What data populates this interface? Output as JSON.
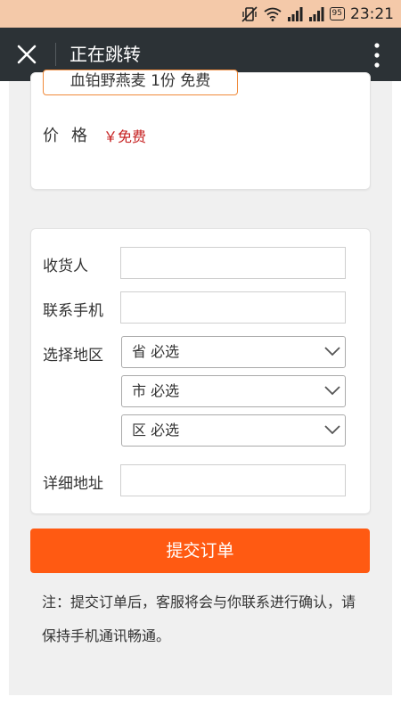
{
  "status_bar": {
    "battery": "95",
    "time": "23:21"
  },
  "title_bar": {
    "title": "正在跳转"
  },
  "product": {
    "tag": "血铂野燕麦 1份 免费",
    "price_label": "价格",
    "price_value": "￥免费"
  },
  "form": {
    "recipient_label": "收货人",
    "recipient_value": "",
    "phone_label": "联系手机",
    "phone_value": "",
    "region_label": "选择地区",
    "province_select": "省 必选",
    "city_select": "市 必选",
    "district_select": "区 必选",
    "address_label": "详细地址",
    "address_value": ""
  },
  "submit_label": "提交订单",
  "note": "注：提交订单后，客服将会与你联系进行确认，请保持手机通讯畅通。"
}
